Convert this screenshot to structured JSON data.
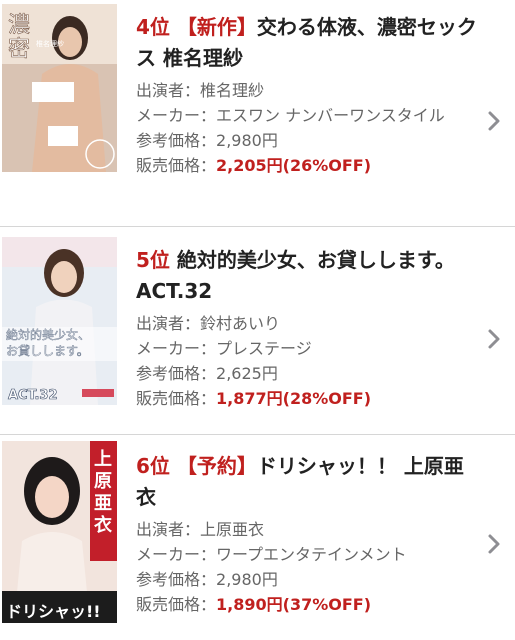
{
  "items": [
    {
      "rank": "4位",
      "tag": "【新作】",
      "title": "交わる体液、濃密セックス 椎名理紗",
      "performer_label": "出演者：",
      "performer": "椎名理紗",
      "maker_label": "メーカー：",
      "maker": "エスワン ナンバーワンスタイル",
      "ref_price_label": "参考価格：",
      "ref_price": "2,980円",
      "sale_price_label": "販売価格：",
      "sale_price": "2,205円(26%OFF)",
      "thumb": {
        "text_main": "濃密",
        "text_sub": "椎名理紗",
        "colors": [
          "#8a6e5e",
          "#c8a48c",
          "#f0e0d2"
        ]
      }
    },
    {
      "rank": "5位",
      "tag": "",
      "title": "絶対的美少女、お貸しします。 ACT.32",
      "performer_label": "出演者：",
      "performer": "鈴村あいり",
      "maker_label": "メーカー：",
      "maker": "プレステージ",
      "ref_price_label": "参考価格：",
      "ref_price": "2,625円",
      "sale_price_label": "販売価格：",
      "sale_price": "1,877円(28%OFF)",
      "thumb": {
        "text_main": "絶対的美少女、お貸しします。",
        "text_sub": "ACT.32",
        "colors": [
          "#dfe6ef",
          "#f6ece4",
          "#b9c6d8"
        ]
      }
    },
    {
      "rank": "6位",
      "tag": "【予約】",
      "title": "ドリシャッ！！ 上原亜衣",
      "performer_label": "出演者：",
      "performer": "上原亜衣",
      "maker_label": "メーカー：",
      "maker": "ワープエンタテインメント",
      "ref_price_label": "参考価格：",
      "ref_price": "2,980円",
      "sale_price_label": "販売価格：",
      "sale_price": "1,890円(37%OFF)",
      "thumb": {
        "text_main": "上原亜衣",
        "text_sub": "ドリシャッ!!",
        "colors": [
          "#c21f2a",
          "#f3d9cf",
          "#2a2a2a"
        ]
      }
    }
  ],
  "icons": {
    "chevron": "chevron-right-icon"
  },
  "colors": {
    "accent": "#c0201e",
    "divider": "#d6d6d6",
    "text_gray": "#666666"
  }
}
